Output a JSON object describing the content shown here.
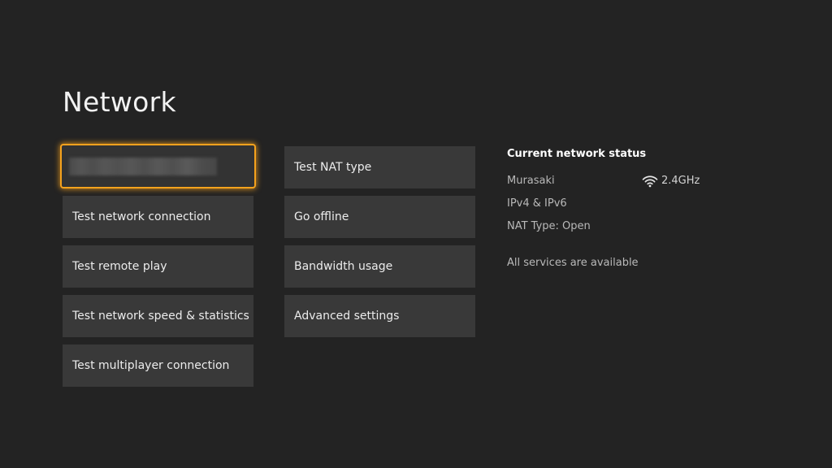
{
  "page": {
    "title": "Network"
  },
  "colors": {
    "background": "#232323",
    "tile": "#393939",
    "focus_accent": "#f5a21d"
  },
  "left_column": {
    "items": [
      {
        "label": "",
        "focused": true,
        "redacted": true
      },
      {
        "label": "Test network connection"
      },
      {
        "label": "Test remote play"
      },
      {
        "label": "Test network speed & statistics"
      },
      {
        "label": "Test multiplayer connection"
      }
    ]
  },
  "middle_column": {
    "items": [
      {
        "label": "Test NAT type"
      },
      {
        "label": "Go offline"
      },
      {
        "label": "Bandwidth usage"
      },
      {
        "label": "Advanced settings"
      }
    ]
  },
  "status": {
    "title": "Current network status",
    "network_name": "Murasaki",
    "signal_icon": "wifi-icon",
    "band": "2.4GHz",
    "ip_version": "IPv4 & IPv6",
    "nat_type": "NAT Type: Open",
    "services": "All services are available"
  }
}
